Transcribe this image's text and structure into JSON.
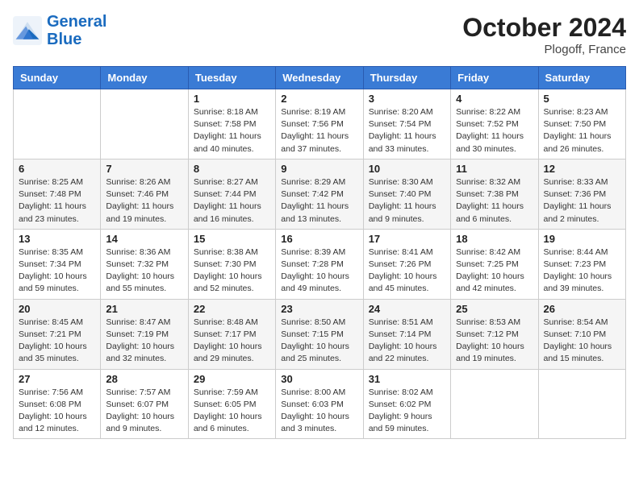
{
  "header": {
    "logo_line1": "General",
    "logo_line2": "Blue",
    "month": "October 2024",
    "location": "Plogoff, France"
  },
  "weekdays": [
    "Sunday",
    "Monday",
    "Tuesday",
    "Wednesday",
    "Thursday",
    "Friday",
    "Saturday"
  ],
  "weeks": [
    [
      {
        "day": "",
        "info": ""
      },
      {
        "day": "",
        "info": ""
      },
      {
        "day": "1",
        "info": "Sunrise: 8:18 AM\nSunset: 7:58 PM\nDaylight: 11 hours and 40 minutes."
      },
      {
        "day": "2",
        "info": "Sunrise: 8:19 AM\nSunset: 7:56 PM\nDaylight: 11 hours and 37 minutes."
      },
      {
        "day": "3",
        "info": "Sunrise: 8:20 AM\nSunset: 7:54 PM\nDaylight: 11 hours and 33 minutes."
      },
      {
        "day": "4",
        "info": "Sunrise: 8:22 AM\nSunset: 7:52 PM\nDaylight: 11 hours and 30 minutes."
      },
      {
        "day": "5",
        "info": "Sunrise: 8:23 AM\nSunset: 7:50 PM\nDaylight: 11 hours and 26 minutes."
      }
    ],
    [
      {
        "day": "6",
        "info": "Sunrise: 8:25 AM\nSunset: 7:48 PM\nDaylight: 11 hours and 23 minutes."
      },
      {
        "day": "7",
        "info": "Sunrise: 8:26 AM\nSunset: 7:46 PM\nDaylight: 11 hours and 19 minutes."
      },
      {
        "day": "8",
        "info": "Sunrise: 8:27 AM\nSunset: 7:44 PM\nDaylight: 11 hours and 16 minutes."
      },
      {
        "day": "9",
        "info": "Sunrise: 8:29 AM\nSunset: 7:42 PM\nDaylight: 11 hours and 13 minutes."
      },
      {
        "day": "10",
        "info": "Sunrise: 8:30 AM\nSunset: 7:40 PM\nDaylight: 11 hours and 9 minutes."
      },
      {
        "day": "11",
        "info": "Sunrise: 8:32 AM\nSunset: 7:38 PM\nDaylight: 11 hours and 6 minutes."
      },
      {
        "day": "12",
        "info": "Sunrise: 8:33 AM\nSunset: 7:36 PM\nDaylight: 11 hours and 2 minutes."
      }
    ],
    [
      {
        "day": "13",
        "info": "Sunrise: 8:35 AM\nSunset: 7:34 PM\nDaylight: 10 hours and 59 minutes."
      },
      {
        "day": "14",
        "info": "Sunrise: 8:36 AM\nSunset: 7:32 PM\nDaylight: 10 hours and 55 minutes."
      },
      {
        "day": "15",
        "info": "Sunrise: 8:38 AM\nSunset: 7:30 PM\nDaylight: 10 hours and 52 minutes."
      },
      {
        "day": "16",
        "info": "Sunrise: 8:39 AM\nSunset: 7:28 PM\nDaylight: 10 hours and 49 minutes."
      },
      {
        "day": "17",
        "info": "Sunrise: 8:41 AM\nSunset: 7:26 PM\nDaylight: 10 hours and 45 minutes."
      },
      {
        "day": "18",
        "info": "Sunrise: 8:42 AM\nSunset: 7:25 PM\nDaylight: 10 hours and 42 minutes."
      },
      {
        "day": "19",
        "info": "Sunrise: 8:44 AM\nSunset: 7:23 PM\nDaylight: 10 hours and 39 minutes."
      }
    ],
    [
      {
        "day": "20",
        "info": "Sunrise: 8:45 AM\nSunset: 7:21 PM\nDaylight: 10 hours and 35 minutes."
      },
      {
        "day": "21",
        "info": "Sunrise: 8:47 AM\nSunset: 7:19 PM\nDaylight: 10 hours and 32 minutes."
      },
      {
        "day": "22",
        "info": "Sunrise: 8:48 AM\nSunset: 7:17 PM\nDaylight: 10 hours and 29 minutes."
      },
      {
        "day": "23",
        "info": "Sunrise: 8:50 AM\nSunset: 7:15 PM\nDaylight: 10 hours and 25 minutes."
      },
      {
        "day": "24",
        "info": "Sunrise: 8:51 AM\nSunset: 7:14 PM\nDaylight: 10 hours and 22 minutes."
      },
      {
        "day": "25",
        "info": "Sunrise: 8:53 AM\nSunset: 7:12 PM\nDaylight: 10 hours and 19 minutes."
      },
      {
        "day": "26",
        "info": "Sunrise: 8:54 AM\nSunset: 7:10 PM\nDaylight: 10 hours and 15 minutes."
      }
    ],
    [
      {
        "day": "27",
        "info": "Sunrise: 7:56 AM\nSunset: 6:08 PM\nDaylight: 10 hours and 12 minutes."
      },
      {
        "day": "28",
        "info": "Sunrise: 7:57 AM\nSunset: 6:07 PM\nDaylight: 10 hours and 9 minutes."
      },
      {
        "day": "29",
        "info": "Sunrise: 7:59 AM\nSunset: 6:05 PM\nDaylight: 10 hours and 6 minutes."
      },
      {
        "day": "30",
        "info": "Sunrise: 8:00 AM\nSunset: 6:03 PM\nDaylight: 10 hours and 3 minutes."
      },
      {
        "day": "31",
        "info": "Sunrise: 8:02 AM\nSunset: 6:02 PM\nDaylight: 9 hours and 59 minutes."
      },
      {
        "day": "",
        "info": ""
      },
      {
        "day": "",
        "info": ""
      }
    ]
  ]
}
